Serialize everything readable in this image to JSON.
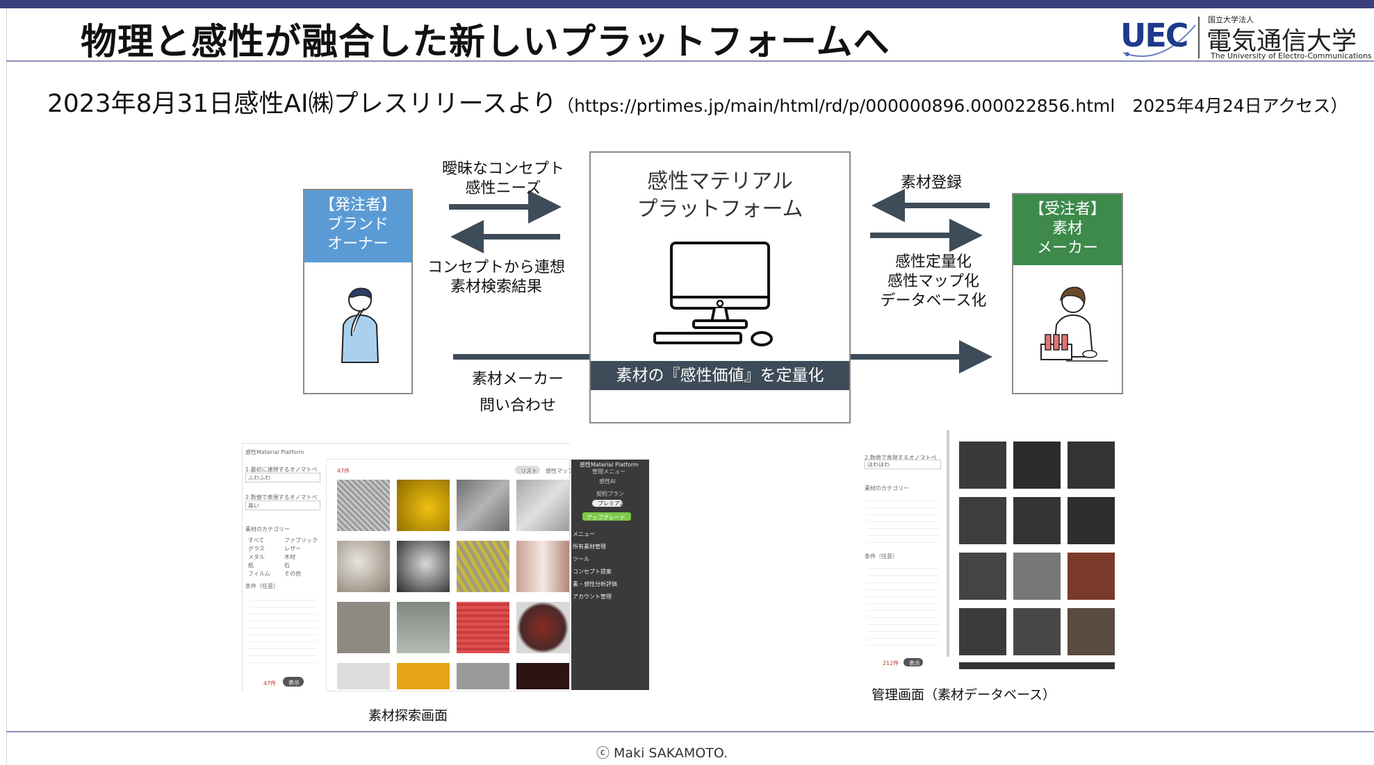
{
  "slide": {
    "title": "物理と感性が融合した新しいプラットフォームへ",
    "press_main": "2023年8月31日感性AI㈱プレスリリースより",
    "press_url": "（https://prtimes.jp/main/html/rd/p/000000896.000022856.html　2025年4月24日アクセス）",
    "copyright": "ⓒ Maki SAKAMOTO."
  },
  "logo": {
    "uec": "UEC",
    "small": "国立大学法人",
    "name": "電気通信大学",
    "en": "The University of Electro-Communications"
  },
  "diagram": {
    "orderer": "【発注者】\nブランド\nオーナー",
    "supplier": "【受注者】\n素材\nメーカー",
    "platform_title": "感性マテリアル\nプラットフォーム",
    "platform_band": "素材の『感性価値』を定量化",
    "arrow_to_platform": "曖昧なコンセプト\n感性ニーズ",
    "arrow_from_platform": "コンセプトから連想\n素材検索結果",
    "supplier_register": "素材登録",
    "quantify": "感性定量化\n感性マップ化\nデータベース化",
    "inquiry": "素材メーカー\n問い合わせ"
  },
  "captions": {
    "search_screen": "素材探索画面",
    "admin_screen": "管理画面（素材データベース）"
  },
  "search_ui": {
    "app_name": "感性Material Platform",
    "count": "47件",
    "count_bottom": "47件",
    "show_btn": "表示",
    "tab_list": "リスト",
    "tab_map": "感性マップ",
    "field1": "1.最初に連想するオノマトペ",
    "field1_val": "ふわふわ",
    "field2": "2.数値で表現するオノマトペ",
    "field2_val": "高い",
    "category": "素材のカテゴリー",
    "options": [
      "すべて",
      "ファブリック",
      "グラス",
      "レザー",
      "メタル",
      "木材",
      "紙",
      "石",
      "フィルム",
      "その他"
    ],
    "condition": "条件（任意）",
    "menu_title": "感性Material Platform",
    "menu_sub": "管理メニュー",
    "menu_ai": "感性AI",
    "menu_plan": "契約プラン",
    "menu_btn1": "プレミアム",
    "menu_btn2": "アップグレード",
    "menu_items": [
      "メニュー",
      "所有素材管理",
      "ツール",
      "コンセプト提案",
      "素・感性分析評価",
      "アカウント管理"
    ]
  },
  "admin_ui": {
    "field": "2.数値で表現するオノマトペ",
    "field_val": "ほわほわ",
    "category": "素材のカテゴリー",
    "count": "212件",
    "show_btn": "表示",
    "condition": "条件（任意）"
  },
  "colors": {
    "orderer": "#5b9bd5",
    "supplier": "#3d8a4b",
    "band": "#3e4b58",
    "accent": "#3b3f7a"
  },
  "icons": [
    "person-thinking-icon",
    "scientist-icon",
    "computer-icon"
  ]
}
